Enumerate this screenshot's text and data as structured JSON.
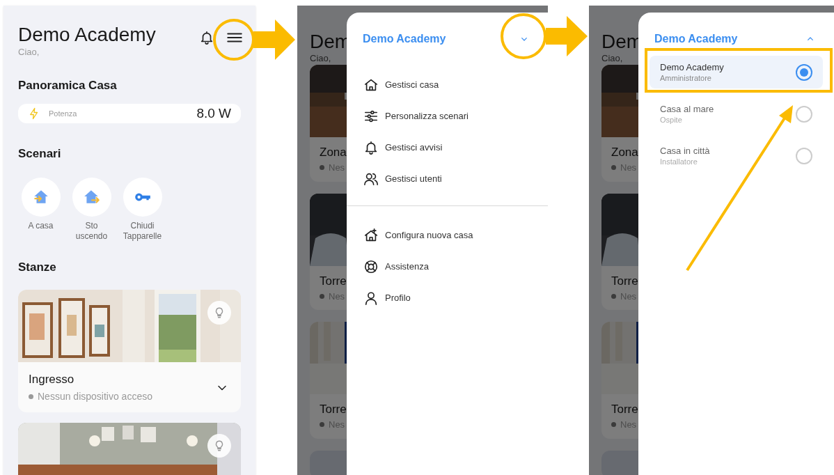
{
  "screen_1": {
    "title": "Demo Academy",
    "greeting": "Ciao,",
    "overview": {
      "heading": "Panoramica Casa",
      "power": {
        "label": "Potenza",
        "value": "8.0 W"
      }
    },
    "scenes": {
      "heading": "Scenari",
      "items": [
        {
          "kind": "arrive",
          "label": "A casa"
        },
        {
          "kind": "leave",
          "label": "Sto uscendo"
        },
        {
          "kind": "key",
          "label": "Chiudi Tapparelle"
        }
      ]
    },
    "rooms": {
      "heading": "Stanze",
      "items": [
        {
          "kind": "room",
          "name": "Ingresso",
          "status": "Nessun dispositivo acceso",
          "expanded": false
        },
        {
          "kind": "picture"
        }
      ]
    }
  },
  "screen_2": {
    "background": {
      "title": "Dem",
      "greeting": "Ciao,",
      "rooms": [
        {
          "name": "Zona",
          "status": "Nes"
        },
        {
          "name": "Torre",
          "status": "Nes"
        },
        {
          "name": "Torre",
          "status": "Nes"
        }
      ]
    },
    "drawer": {
      "home": "Demo Academy",
      "expanded": false,
      "menu": [
        {
          "kind": "home",
          "label": "Gestisci casa"
        },
        {
          "kind": "sliders",
          "label": "Personalizza scenari"
        },
        {
          "kind": "bell",
          "label": "Gestisci avvisi"
        },
        {
          "kind": "users",
          "label": "Gestisci utenti"
        },
        {
          "kind": "divider"
        },
        {
          "kind": "home-plus",
          "label": "Configura nuova casa"
        },
        {
          "kind": "lifebuoy",
          "label": "Assistenza"
        },
        {
          "kind": "user",
          "label": "Profilo"
        }
      ]
    }
  },
  "screen_3": {
    "background": {
      "title": "Dem",
      "greeting": "Ciao,",
      "rooms": [
        {
          "name": "Zona",
          "status": "Nes"
        },
        {
          "name": "Torre",
          "status": "Nes"
        },
        {
          "name": "Torre",
          "status": "Nes"
        }
      ]
    },
    "drawer": {
      "home": "Demo Academy",
      "expanded": true,
      "homes": [
        {
          "name": "Demo Academy",
          "role": "Amministratore",
          "selected": true
        },
        {
          "name": "Casa al mare",
          "role": "Ospite",
          "selected": false
        },
        {
          "name": "Casa in città",
          "role": "Installatore",
          "selected": false
        }
      ]
    }
  }
}
